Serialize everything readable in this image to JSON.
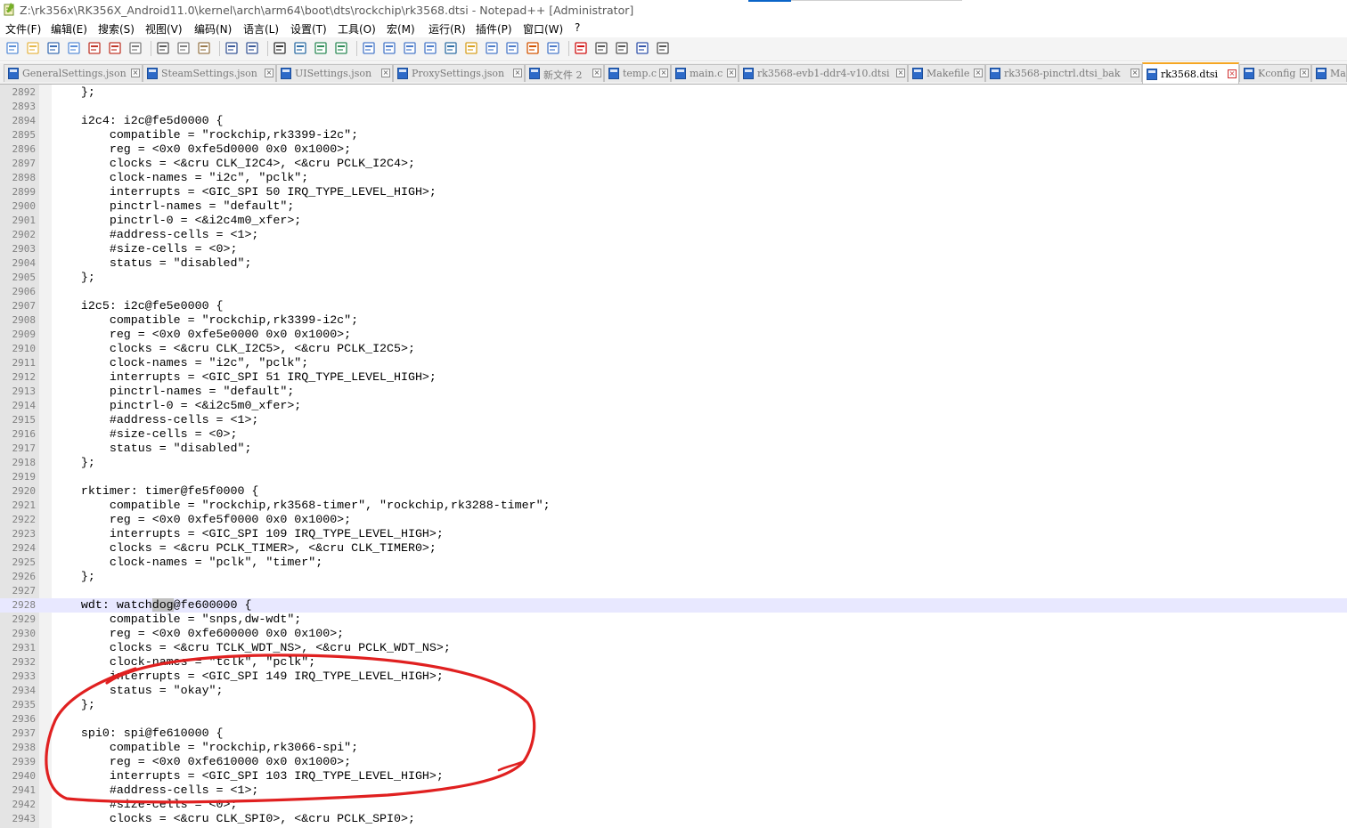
{
  "window": {
    "title": "Z:\\rk356x\\RK356X_Android11.0\\kernel\\arch\\arm64\\boot\\dts\\rockchip\\rk3568.dtsi - Notepad++ [Administrator]"
  },
  "menu": [
    "文件(F)",
    "编辑(E)",
    "搜索(S)",
    "视图(V)",
    "编码(N)",
    "语言(L)",
    "设置(T)",
    "工具(O)",
    "宏(M)",
    "运行(R)",
    "插件(P)",
    "窗口(W)",
    "?"
  ],
  "toolbar_icons": [
    "new-file-icon",
    "open-file-icon",
    "save-icon",
    "save-all-icon",
    "close-icon",
    "close-all-icon",
    "print-icon",
    "cut-icon",
    "copy-icon",
    "paste-icon",
    "undo-icon",
    "redo-icon",
    "find-icon",
    "replace-icon",
    "zoom-in-icon",
    "zoom-out-icon",
    "sync-vertical-icon",
    "sync-horizontal-icon",
    "word-wrap-icon",
    "show-all-chars-icon",
    "indent-guide-icon",
    "lang-icon",
    "doc-map-icon",
    "function-list-icon",
    "folder-workspace-icon",
    "monitor-icon",
    "record-macro-icon",
    "stop-macro-icon",
    "play-macro-icon",
    "run-macro-multiple-icon",
    "save-macro-icon"
  ],
  "tabs": [
    {
      "label": "GeneralSettings.json",
      "active": false
    },
    {
      "label": "SteamSettings.json",
      "active": false
    },
    {
      "label": "UISettings.json",
      "active": false
    },
    {
      "label": "ProxySettings.json",
      "active": false
    },
    {
      "label": "新文件 2",
      "active": false
    },
    {
      "label": "temp.c",
      "active": false
    },
    {
      "label": "main.c",
      "active": false
    },
    {
      "label": "rk3568-evb1-ddr4-v10.dtsi",
      "active": false
    },
    {
      "label": "Makefile",
      "active": false
    },
    {
      "label": "rk3568-pinctrl.dtsi_bak",
      "active": false
    },
    {
      "label": "rk3568.dtsi",
      "active": true
    },
    {
      "label": "Kconfig",
      "active": false
    },
    {
      "label": "Mak",
      "active": false
    }
  ],
  "editor": {
    "current_line": 2928,
    "search_highlight": "dog",
    "lines": [
      {
        "n": "2892",
        "t": "    };"
      },
      {
        "n": "2893",
        "t": ""
      },
      {
        "n": "2894",
        "t": "    i2c4: i2c@fe5d0000 {"
      },
      {
        "n": "2895",
        "t": "        compatible = \"rockchip,rk3399-i2c\";"
      },
      {
        "n": "2896",
        "t": "        reg = <0x0 0xfe5d0000 0x0 0x1000>;"
      },
      {
        "n": "2897",
        "t": "        clocks = <&cru CLK_I2C4>, <&cru PCLK_I2C4>;"
      },
      {
        "n": "2898",
        "t": "        clock-names = \"i2c\", \"pclk\";"
      },
      {
        "n": "2899",
        "t": "        interrupts = <GIC_SPI 50 IRQ_TYPE_LEVEL_HIGH>;"
      },
      {
        "n": "2900",
        "t": "        pinctrl-names = \"default\";"
      },
      {
        "n": "2901",
        "t": "        pinctrl-0 = <&i2c4m0_xfer>;"
      },
      {
        "n": "2902",
        "t": "        #address-cells = <1>;"
      },
      {
        "n": "2903",
        "t": "        #size-cells = <0>;"
      },
      {
        "n": "2904",
        "t": "        status = \"disabled\";"
      },
      {
        "n": "2905",
        "t": "    };"
      },
      {
        "n": "2906",
        "t": ""
      },
      {
        "n": "2907",
        "t": "    i2c5: i2c@fe5e0000 {"
      },
      {
        "n": "2908",
        "t": "        compatible = \"rockchip,rk3399-i2c\";"
      },
      {
        "n": "2909",
        "t": "        reg = <0x0 0xfe5e0000 0x0 0x1000>;"
      },
      {
        "n": "2910",
        "t": "        clocks = <&cru CLK_I2C5>, <&cru PCLK_I2C5>;"
      },
      {
        "n": "2911",
        "t": "        clock-names = \"i2c\", \"pclk\";"
      },
      {
        "n": "2912",
        "t": "        interrupts = <GIC_SPI 51 IRQ_TYPE_LEVEL_HIGH>;"
      },
      {
        "n": "2913",
        "t": "        pinctrl-names = \"default\";"
      },
      {
        "n": "2914",
        "t": "        pinctrl-0 = <&i2c5m0_xfer>;"
      },
      {
        "n": "2915",
        "t": "        #address-cells = <1>;"
      },
      {
        "n": "2916",
        "t": "        #size-cells = <0>;"
      },
      {
        "n": "2917",
        "t": "        status = \"disabled\";"
      },
      {
        "n": "2918",
        "t": "    };"
      },
      {
        "n": "2919",
        "t": ""
      },
      {
        "n": "2920",
        "t": "    rktimer: timer@fe5f0000 {"
      },
      {
        "n": "2921",
        "t": "        compatible = \"rockchip,rk3568-timer\", \"rockchip,rk3288-timer\";"
      },
      {
        "n": "2922",
        "t": "        reg = <0x0 0xfe5f0000 0x0 0x1000>;"
      },
      {
        "n": "2923",
        "t": "        interrupts = <GIC_SPI 109 IRQ_TYPE_LEVEL_HIGH>;"
      },
      {
        "n": "2924",
        "t": "        clocks = <&cru PCLK_TIMER>, <&cru CLK_TIMER0>;"
      },
      {
        "n": "2925",
        "t": "        clock-names = \"pclk\", \"timer\";"
      },
      {
        "n": "2926",
        "t": "    };"
      },
      {
        "n": "2927",
        "t": ""
      },
      {
        "n": "2928",
        "t": "    wdt: watchdog@fe600000 {"
      },
      {
        "n": "2929",
        "t": "        compatible = \"snps,dw-wdt\";"
      },
      {
        "n": "2930",
        "t": "        reg = <0x0 0xfe600000 0x0 0x100>;"
      },
      {
        "n": "2931",
        "t": "        clocks = <&cru TCLK_WDT_NS>, <&cru PCLK_WDT_NS>;"
      },
      {
        "n": "2932",
        "t": "        clock-names = \"tclk\", \"pclk\";"
      },
      {
        "n": "2933",
        "t": "        interrupts = <GIC_SPI 149 IRQ_TYPE_LEVEL_HIGH>;"
      },
      {
        "n": "2934",
        "t": "        status = \"okay\";"
      },
      {
        "n": "2935",
        "t": "    };"
      },
      {
        "n": "2936",
        "t": ""
      },
      {
        "n": "2937",
        "t": "    spi0: spi@fe610000 {"
      },
      {
        "n": "2938",
        "t": "        compatible = \"rockchip,rk3066-spi\";"
      },
      {
        "n": "2939",
        "t": "        reg = <0x0 0xfe610000 0x0 0x1000>;"
      },
      {
        "n": "2940",
        "t": "        interrupts = <GIC_SPI 103 IRQ_TYPE_LEVEL_HIGH>;"
      },
      {
        "n": "2941",
        "t": "        #address-cells = <1>;"
      },
      {
        "n": "2942",
        "t": "        #size-cells = <0>;"
      },
      {
        "n": "2943",
        "t": "        clocks = <&cru CLK_SPI0>, <&cru PCLK_SPI0>;"
      }
    ]
  },
  "annotation": {
    "color": "#e02020"
  }
}
